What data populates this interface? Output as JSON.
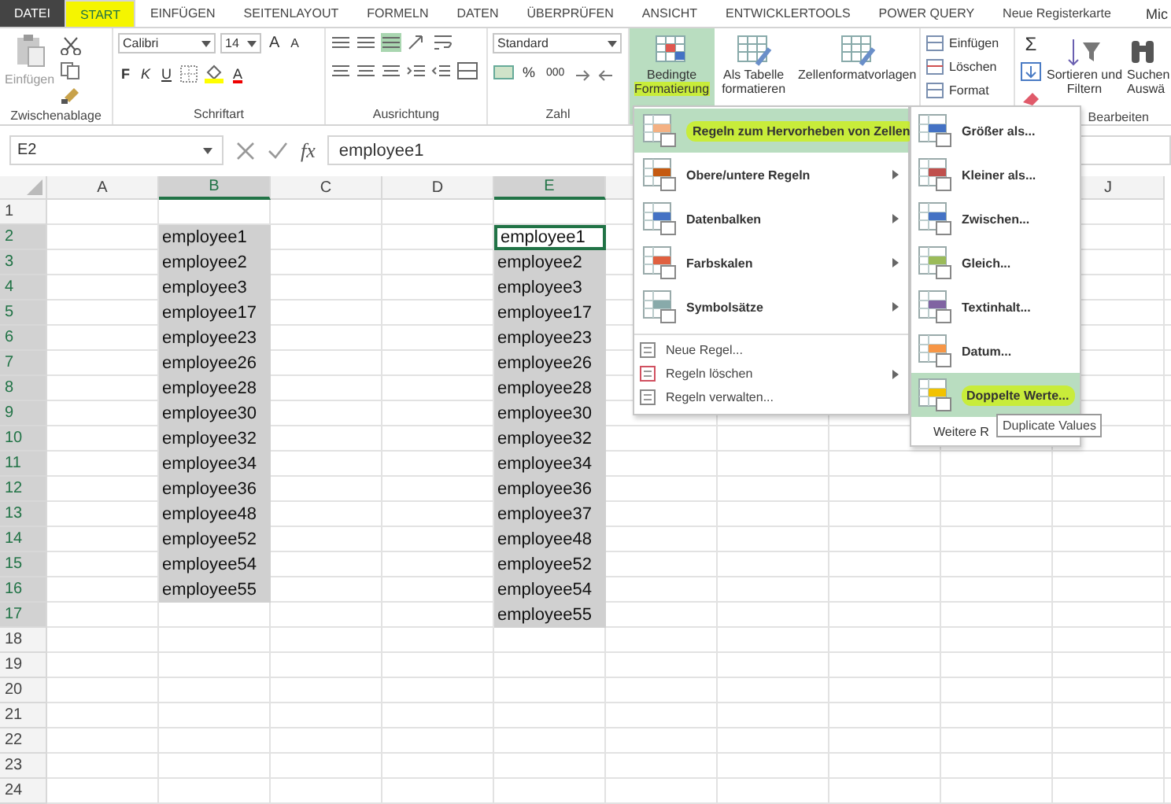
{
  "tabs": [
    {
      "label": "DATEI",
      "kind": "file",
      "selected": false,
      "marked": false
    },
    {
      "label": "START",
      "kind": "tab",
      "selected": true,
      "marked": true
    },
    {
      "label": "EINFÜGEN",
      "kind": "tab",
      "selected": false,
      "marked": false
    },
    {
      "label": "SEITENLAYOUT",
      "kind": "tab",
      "selected": false,
      "marked": false
    },
    {
      "label": "FORMELN",
      "kind": "tab",
      "selected": false,
      "marked": false
    },
    {
      "label": "DATEN",
      "kind": "tab",
      "selected": false,
      "marked": false
    },
    {
      "label": "ÜBERPRÜFEN",
      "kind": "tab",
      "selected": false,
      "marked": false
    },
    {
      "label": "ANSICHT",
      "kind": "tab",
      "selected": false,
      "marked": false
    },
    {
      "label": "ENTWICKLERTOOLS",
      "kind": "tab",
      "selected": false,
      "marked": false
    },
    {
      "label": "POWER QUERY",
      "kind": "tab",
      "selected": false,
      "marked": false
    },
    {
      "label": "Neue Registerkarte",
      "kind": "tab",
      "selected": false,
      "marked": false
    }
  ],
  "account": "Mic",
  "ribbon": {
    "clipboard": {
      "paste": "Einfügen",
      "label": "Zwischenablage"
    },
    "font": {
      "name": "Calibri",
      "size": "14",
      "grow": "A",
      "shrink": "A",
      "bold": "F",
      "italic": "K",
      "underline": "U",
      "color_letter": "A",
      "label": "Schriftart"
    },
    "alignment": {
      "label": "Ausrichtung"
    },
    "number": {
      "format": "Standard",
      "percent": "%",
      "thousands": "000",
      "label": "Zahl"
    },
    "styles": [
      {
        "lines": [
          "Bedingte",
          "Formatierung"
        ],
        "selected": true,
        "marked": true
      },
      {
        "lines": [
          "Als Tabelle",
          "formatieren"
        ],
        "selected": false,
        "marked": false
      },
      {
        "lines": [
          "Zellenformatvorlagen"
        ],
        "selected": false,
        "marked": false
      }
    ],
    "cells": [
      "Einfügen",
      "Löschen",
      "Format"
    ],
    "editing": {
      "sigma": "Σ",
      "sort": [
        "Sortieren und",
        "Filtern"
      ],
      "find": [
        "Suchen",
        "Auswä"
      ],
      "label": "Bearbeiten"
    }
  },
  "formula_bar": {
    "name_box": "E2",
    "fx": "fx",
    "value": "employee1"
  },
  "columns": [
    {
      "label": "A",
      "selected": false
    },
    {
      "label": "B",
      "selected": true
    },
    {
      "label": "C",
      "selected": false
    },
    {
      "label": "D",
      "selected": false
    },
    {
      "label": "E",
      "selected": true
    },
    {
      "label": "J",
      "selected": false
    }
  ],
  "rows": [
    {
      "label": "1",
      "selected": false
    },
    {
      "label": "2",
      "selected": true,
      "b": {
        "text": "employee1",
        "selected": true
      },
      "e": {
        "text": "employee1",
        "active": true
      }
    },
    {
      "label": "3",
      "selected": true,
      "b": {
        "text": "employee2",
        "selected": true
      },
      "e": {
        "text": "employee2",
        "selected": true,
        "active": false
      }
    },
    {
      "label": "4",
      "selected": true,
      "b": {
        "text": "employee3",
        "selected": true
      },
      "e": {
        "text": "employee3",
        "selected": true,
        "active": false
      }
    },
    {
      "label": "5",
      "selected": true,
      "b": {
        "text": "employee17",
        "selected": true
      },
      "e": {
        "text": "employee17",
        "selected": true,
        "active": false
      }
    },
    {
      "label": "6",
      "selected": true,
      "b": {
        "text": "employee23",
        "selected": true
      },
      "e": {
        "text": "employee23",
        "selected": true,
        "active": false
      }
    },
    {
      "label": "7",
      "selected": true,
      "b": {
        "text": "employee26",
        "selected": true
      },
      "e": {
        "text": "employee26",
        "selected": true,
        "active": false
      }
    },
    {
      "label": "8",
      "selected": true,
      "b": {
        "text": "employee28",
        "selected": true
      },
      "e": {
        "text": "employee28",
        "selected": true,
        "active": false
      }
    },
    {
      "label": "9",
      "selected": true,
      "b": {
        "text": "employee30",
        "selected": true
      },
      "e": {
        "text": "employee30",
        "selected": true,
        "active": false
      }
    },
    {
      "label": "10",
      "selected": true,
      "b": {
        "text": "employee32",
        "selected": true
      },
      "e": {
        "text": "employee32",
        "selected": true,
        "active": false
      }
    },
    {
      "label": "11",
      "selected": true,
      "b": {
        "text": "employee34",
        "selected": true
      },
      "e": {
        "text": "employee34",
        "selected": true,
        "active": false
      }
    },
    {
      "label": "12",
      "selected": true,
      "b": {
        "text": "employee36",
        "selected": true
      },
      "e": {
        "text": "employee36",
        "selected": true,
        "active": false
      }
    },
    {
      "label": "13",
      "selected": true,
      "b": {
        "text": "employee48",
        "selected": true
      },
      "e": {
        "text": "employee37",
        "selected": true,
        "active": false
      }
    },
    {
      "label": "14",
      "selected": true,
      "b": {
        "text": "employee52",
        "selected": true
      },
      "e": {
        "text": "employee48",
        "selected": true,
        "active": false
      }
    },
    {
      "label": "15",
      "selected": true,
      "b": {
        "text": "employee54",
        "selected": true
      },
      "e": {
        "text": "employee52",
        "selected": true,
        "active": false
      }
    },
    {
      "label": "16",
      "selected": true,
      "b": {
        "text": "employee55",
        "selected": true
      },
      "e": {
        "text": "employee54",
        "selected": true,
        "active": false
      }
    },
    {
      "label": "17",
      "selected": true,
      "e": {
        "text": "employee55",
        "selected": true,
        "active": false
      }
    },
    {
      "label": "18",
      "selected": false
    },
    {
      "label": "19",
      "selected": false
    },
    {
      "label": "20",
      "selected": false
    },
    {
      "label": "21",
      "selected": false
    },
    {
      "label": "22",
      "selected": false
    },
    {
      "label": "23",
      "selected": false
    },
    {
      "label": "24",
      "selected": false
    }
  ],
  "menu": [
    {
      "kind": "large",
      "label": "Regeln zum Hervorheben von Zellen",
      "submenu": true,
      "selected": true,
      "marked": true
    },
    {
      "kind": "large",
      "label": "Obere/untere Regeln",
      "submenu": true,
      "selected": false,
      "marked": false
    },
    {
      "kind": "large",
      "label": "Datenbalken",
      "submenu": true,
      "selected": false,
      "marked": false
    },
    {
      "kind": "large",
      "label": "Farbskalen",
      "submenu": true,
      "selected": false,
      "marked": false
    },
    {
      "kind": "large",
      "label": "Symbolsätze",
      "submenu": true,
      "selected": false,
      "marked": false
    },
    {
      "kind": "small",
      "label": "Neue Regel...",
      "submenu": false,
      "selected": false,
      "marked": false
    },
    {
      "kind": "small",
      "label": "Regeln löschen",
      "submenu": true,
      "selected": false,
      "marked": false
    },
    {
      "kind": "small",
      "label": "Regeln verwalten...",
      "submenu": false,
      "selected": false,
      "marked": false
    }
  ],
  "submenu": [
    {
      "label": "Größer als...",
      "selected": false,
      "marked": false
    },
    {
      "label": "Kleiner als...",
      "selected": false,
      "marked": false
    },
    {
      "label": "Zwischen...",
      "selected": false,
      "marked": false
    },
    {
      "label": "Gleich...",
      "selected": false,
      "marked": false
    },
    {
      "label": "Textinhalt...",
      "selected": false,
      "marked": false
    },
    {
      "label": "Datum...",
      "selected": false,
      "marked": false
    },
    {
      "label": "Doppelte Werte...",
      "selected": true,
      "marked": true
    }
  ],
  "submenu_more": "Weitere R",
  "tooltip": "Duplicate Values"
}
